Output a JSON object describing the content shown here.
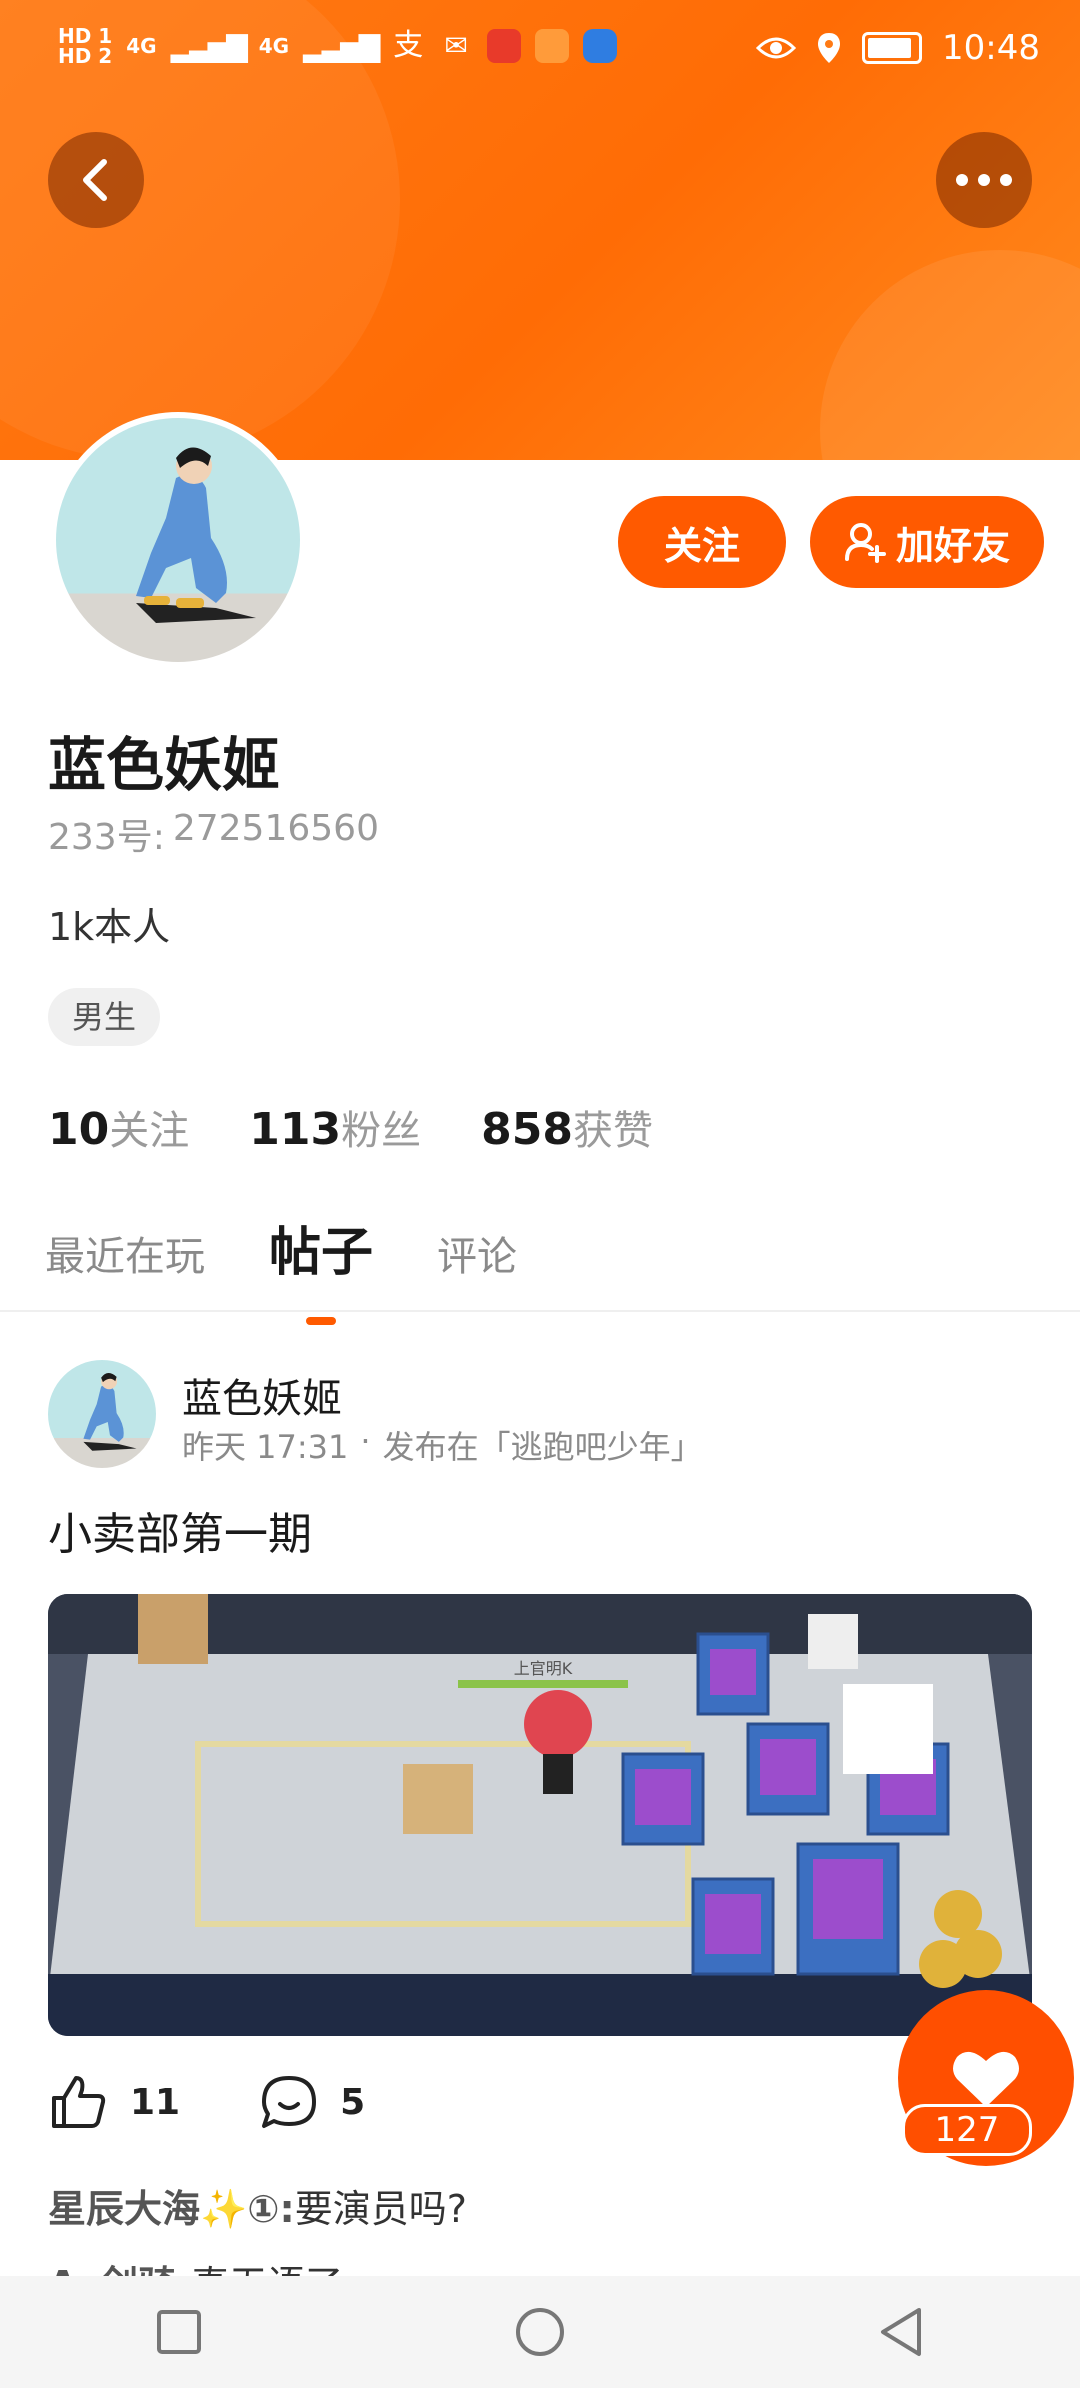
{
  "status_bar": {
    "sim_labels": [
      "HD 1",
      "HD 2"
    ],
    "network": [
      "4G",
      "4G"
    ],
    "time": "10:48"
  },
  "profile": {
    "name": "蓝色妖姬",
    "id_label": "233号:",
    "id_value": "272516560",
    "bio": "1k本人",
    "gender_tag": "男生",
    "follow_button": "关注",
    "add_friend_button": "加好友"
  },
  "stats": [
    {
      "num": "10",
      "label": "关注"
    },
    {
      "num": "113",
      "label": "粉丝"
    },
    {
      "num": "858",
      "label": "获赞"
    }
  ],
  "tabs": [
    {
      "label": "最近在玩",
      "active": false
    },
    {
      "label": "帖子",
      "active": true
    },
    {
      "label": "评论",
      "active": false
    }
  ],
  "post": {
    "author": "蓝色妖姬",
    "time": "昨天 17:31",
    "dot": "·",
    "published_in": "发布在「逃跑吧少年」",
    "title": "小卖部第一期",
    "image_caption": "上官明K",
    "likes": "11",
    "comments": "5"
  },
  "comments": [
    {
      "author": "星辰大海✨①:",
      "text": "要演员吗?"
    },
    {
      "author": "Ac剑骑:",
      "text": "真无语了"
    }
  ],
  "floating_like": {
    "count": "127"
  },
  "icons": [
    "back-arrow-icon",
    "more-icon",
    "add-user-icon",
    "thumb-up-icon",
    "comment-icon",
    "heart-icon",
    "square-icon",
    "circle-icon",
    "triangle-back-icon"
  ],
  "colors": {
    "accent": "#ff5a00",
    "header": "#ff7a14"
  }
}
